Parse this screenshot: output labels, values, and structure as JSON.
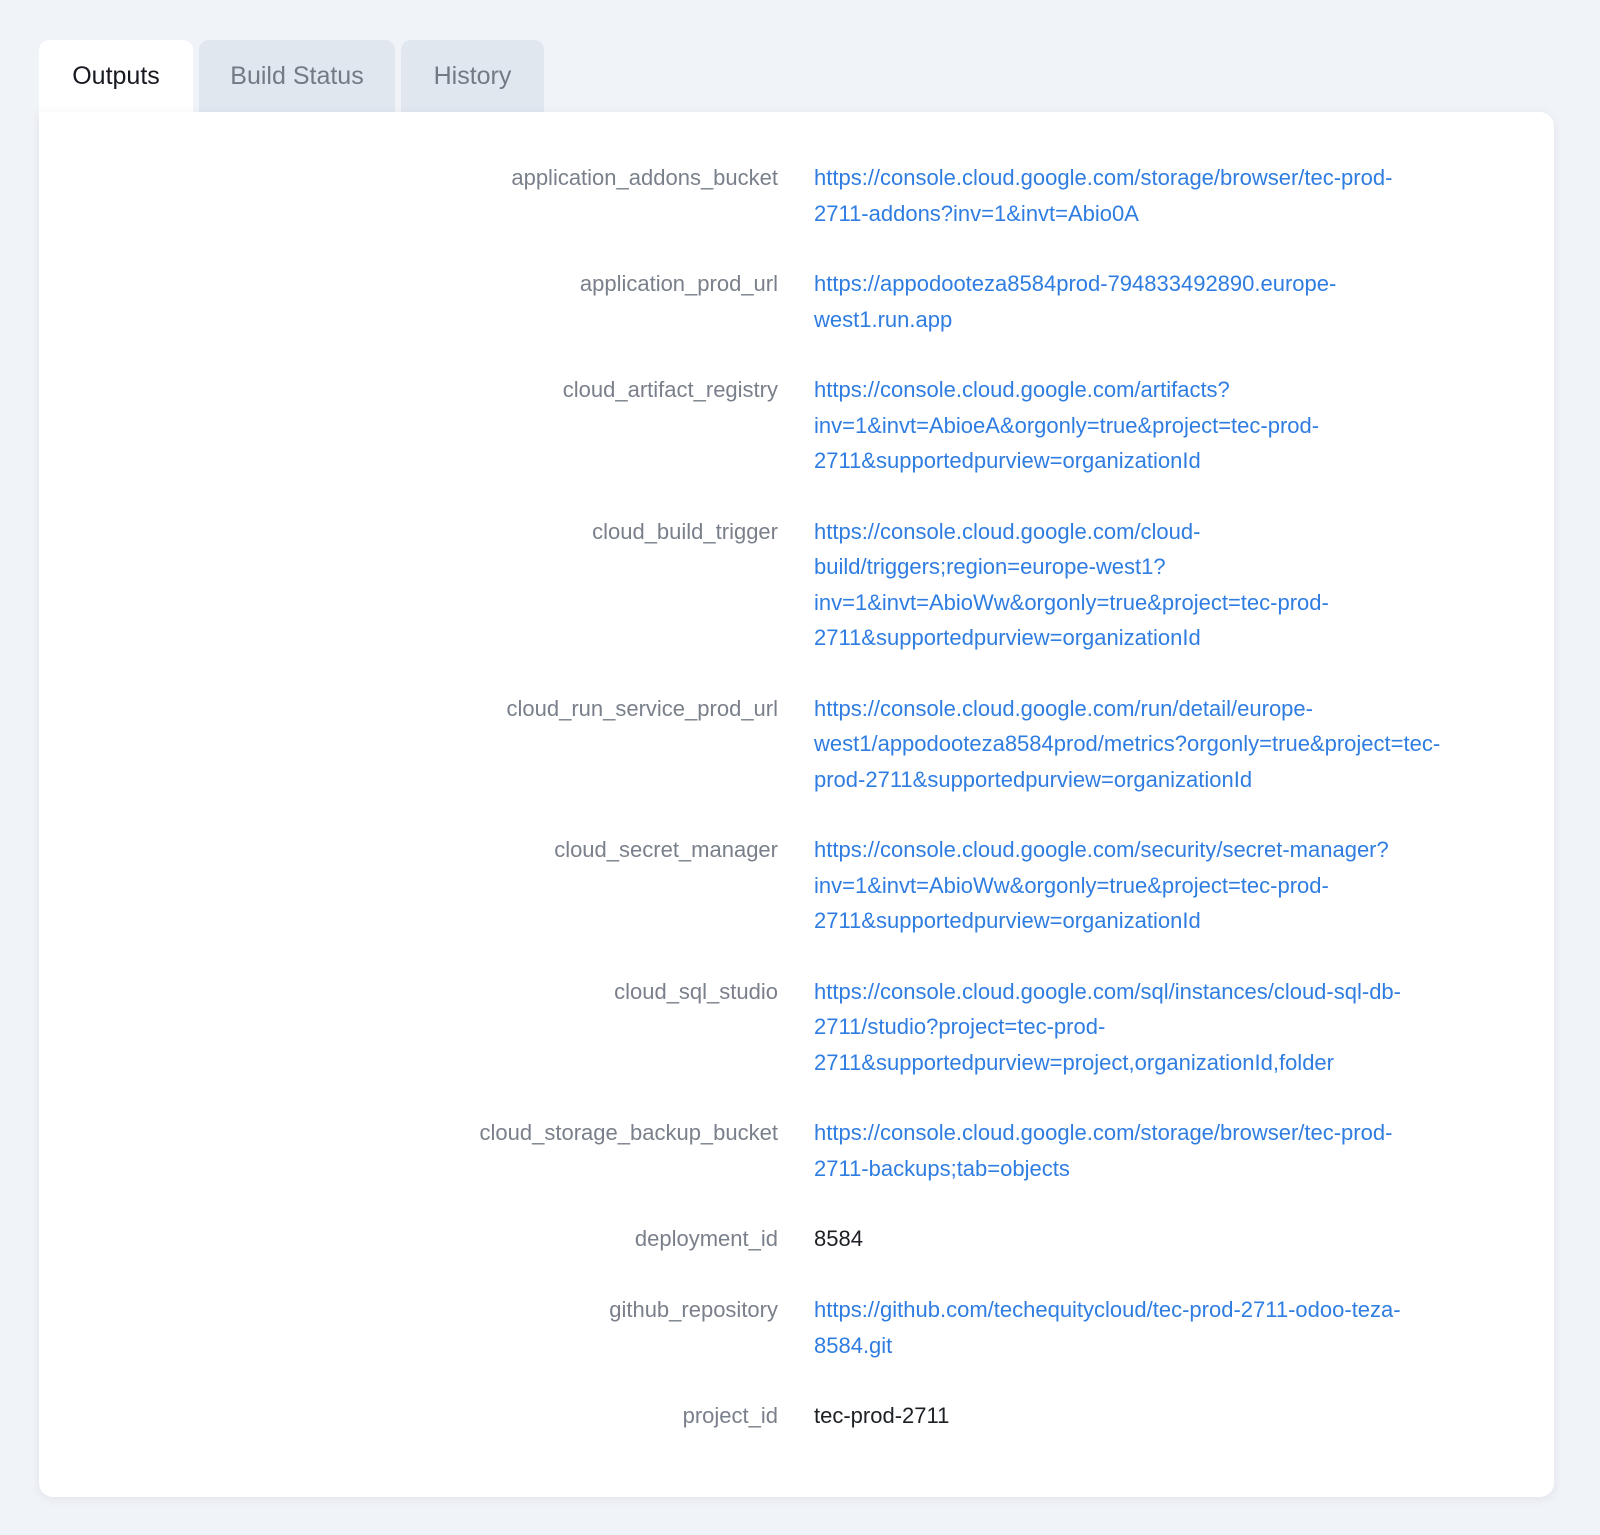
{
  "tabs": [
    {
      "label": "Outputs",
      "active": true
    },
    {
      "label": "Build Status",
      "active": false
    },
    {
      "label": "History",
      "active": false
    }
  ],
  "outputs": [
    {
      "key": "application_addons_bucket",
      "line1": "https://console.cloud.google.com/storage/browser/tec-prod-",
      "line2": "2711-addons?inv=1&invt=Abio0A",
      "line3": "",
      "line4": ""
    },
    {
      "key": "application_prod_url",
      "line1": "https://appodooteza8584prod-794833492890.europe-",
      "line2": "west1.run.app",
      "line3": "",
      "line4": ""
    },
    {
      "key": "cloud_artifact_registry",
      "line1": "https://console.cloud.google.com/artifacts?",
      "line2": "inv=1&invt=AbioeA&orgonly=true&project=tec-prod-",
      "line3": "2711&supportedpurview=organizationId",
      "line4": ""
    },
    {
      "key": "cloud_build_trigger",
      "line1": "https://console.cloud.google.com/cloud-",
      "line2": "build/triggers;region=europe-west1?",
      "line3": "inv=1&invt=AbioWw&orgonly=true&project=tec-prod-",
      "line4": "2711&supportedpurview=organizationId"
    },
    {
      "key": "cloud_run_service_prod_url",
      "line1": "https://console.cloud.google.com/run/detail/europe-",
      "line2": "west1/appodooteza8584prod/metrics?orgonly=true&project=tec-",
      "line3": "prod-2711&supportedpurview=organizationId",
      "line4": ""
    },
    {
      "key": "cloud_secret_manager",
      "line1": "https://console.cloud.google.com/security/secret-manager?",
      "line2": "inv=1&invt=AbioWw&orgonly=true&project=tec-prod-",
      "line3": "2711&supportedpurview=organizationId",
      "line4": ""
    },
    {
      "key": "cloud_sql_studio",
      "line1": "https://console.cloud.google.com/sql/instances/cloud-sql-db-",
      "line2": "2711/studio?project=tec-prod-",
      "line3": "2711&supportedpurview=project,organizationId,folder",
      "line4": ""
    },
    {
      "key": "cloud_storage_backup_bucket",
      "line1": "https://console.cloud.google.com/storage/browser/tec-prod-",
      "line2": "2711-backups;tab=objects",
      "line3": "",
      "line4": ""
    },
    {
      "key": "deployment_id",
      "line1": "8584",
      "line2": "",
      "line3": "",
      "line4": ""
    },
    {
      "key": "github_repository",
      "line1": "https://github.com/techequitycloud/tec-prod-2711-odoo-teza-",
      "line2": "8584.git",
      "line3": "",
      "line4": ""
    },
    {
      "key": "project_id",
      "line1": "tec-prod-2711",
      "line2": "",
      "line3": "",
      "line4": ""
    }
  ]
}
